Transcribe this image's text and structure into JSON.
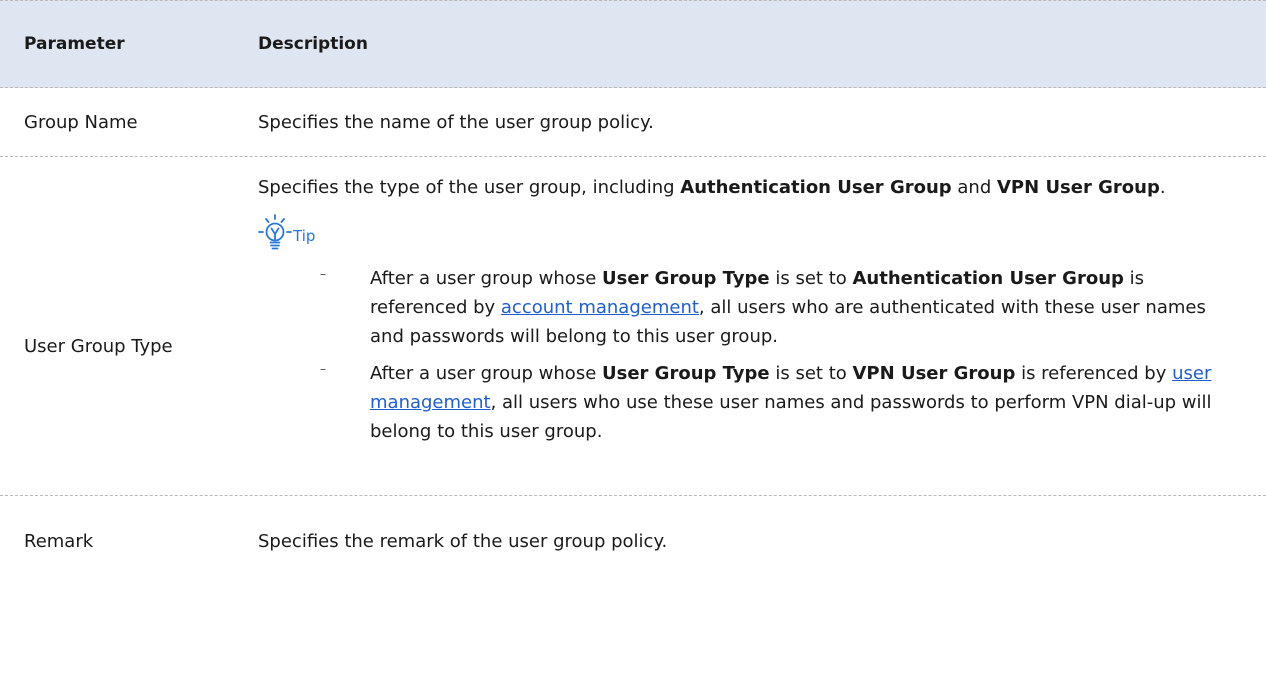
{
  "table": {
    "header": {
      "parameter": "Parameter",
      "description": "Description"
    },
    "rows": {
      "group_name": {
        "parameter": "Group Name",
        "description": "Specifies the name of the user group policy."
      },
      "user_group_type": {
        "parameter": "User Group Type",
        "intro_prefix": "Specifies the type of the user group, including ",
        "intro_bold_1": "Authentication User Group",
        "intro_and": " and ",
        "intro_bold_2": "VPN User Group",
        "intro_suffix": ".",
        "tip_label": "Tip",
        "bullets": {
          "b1": {
            "mark": "–",
            "t1": "After a user group whose ",
            "bold1": "User Group Type",
            "t2": " is set to ",
            "bold2": "Authentication User Group",
            "t3": " is referenced by ",
            "link": "account management",
            "t4": ", all users who are authenticated with these user names and passwords will belong to this user group."
          },
          "b2": {
            "mark": "–",
            "t1": "After a user group whose ",
            "bold1": "User Group Type",
            "t2": " is set to ",
            "bold2": "VPN User Group",
            "t3": " is referenced by ",
            "link": "user management",
            "t4": ", all users who use these user names and passwords to perform VPN dial-up will belong to this user group."
          }
        }
      },
      "remark": {
        "parameter": "Remark",
        "description": "Specifies the remark of the user group policy."
      }
    },
    "colors": {
      "header_bg": "#dde6f1",
      "link": "#1f5fc9",
      "tip_accent": "#2a78d6"
    },
    "icons": {
      "tip": "lightbulb-icon"
    }
  }
}
